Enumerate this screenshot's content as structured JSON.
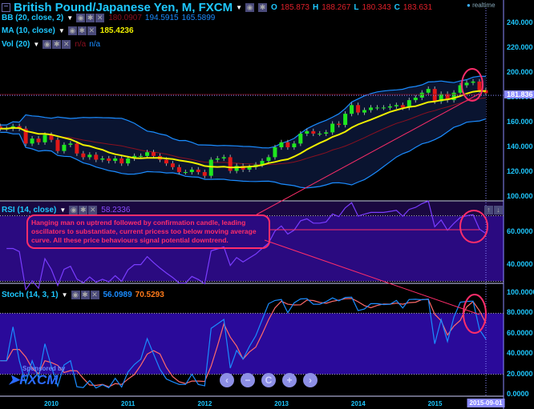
{
  "header": {
    "title": "British Pound/Japanese Yen, M, FXCM",
    "o_label": "O",
    "o": "185.873",
    "h_label": "H",
    "h": "188.267",
    "l_label": "L",
    "l": "180.343",
    "c_label": "C",
    "c": "183.631",
    "realtime": "realtime"
  },
  "indicators": {
    "bb": {
      "label": "BB (20, close, 2)",
      "mid": "180.0907",
      "upper": "194.5915",
      "lower": "165.5899"
    },
    "ma": {
      "label": "MA (10, close)",
      "value": "185.4236"
    },
    "vol": {
      "label": "Vol (20)",
      "v1": "n/a",
      "v2": "n/a"
    },
    "rsi": {
      "label": "RSI (14, close)",
      "value": "58.2336"
    },
    "stoch": {
      "label": "Stoch (14, 3, 1)",
      "k": "56.0989",
      "d": "70.5293"
    }
  },
  "annotation": "Hanging man on uptrend followed by confirmation candle, leading oscillators to substantiate, current pricess too below moving average curve. All these price behaviours signal potential downtrend.",
  "sponsor": {
    "text": "Sponsored by",
    "brand": "FXCM"
  },
  "zoom_controls": [
    "‹",
    "−",
    "C",
    "+",
    "›"
  ],
  "colors": {
    "up": "#1ee81e",
    "down": "#e01818",
    "ma": "#f0f000",
    "bb_band": "#1a8cff",
    "bb_mid": "#8a1020",
    "rsi": "#7a3cff",
    "stoch_k": "#1a8cff",
    "stoch_d": "#ff6a6a",
    "panel_fill": "#2a0a9a",
    "annotation": "#ff2d6a"
  },
  "chart_data": [
    {
      "type": "candlestick",
      "title": "British Pound/Japanese Yen, M, FXCM",
      "start_month": "2009-05",
      "current_price": "181.836",
      "closes": [
        155,
        155,
        157,
        155,
        143,
        147,
        144,
        150,
        146,
        137,
        142,
        143,
        135,
        132,
        134,
        130,
        131,
        129,
        131,
        127,
        131,
        133,
        133,
        136,
        133,
        130,
        127,
        124,
        120,
        120,
        122,
        120,
        117,
        130,
        131,
        132,
        121,
        125,
        122,
        124,
        126,
        129,
        132,
        140,
        144,
        140,
        143,
        151,
        153,
        151,
        151,
        152,
        159,
        158,
        167,
        174,
        168,
        170,
        172,
        172,
        172,
        173,
        174,
        172,
        178,
        180,
        184,
        187,
        177,
        183,
        178,
        184,
        190,
        192,
        193,
        186,
        183.631
      ],
      "y_ticks": [
        "240.000",
        "220.000",
        "200.000",
        "180.000",
        "160.000",
        "140.000",
        "120.000",
        "100.000"
      ],
      "ylim": [
        100,
        240
      ]
    },
    {
      "type": "line",
      "title": "RSI (14, close)",
      "y_ticks": [
        "60.0000",
        "40.0000"
      ],
      "levels": [
        70,
        30
      ]
    },
    {
      "type": "line",
      "title": "Stoch (14, 3, 1)",
      "y_ticks": [
        "100.0000",
        "80.0000",
        "60.0000",
        "40.0000",
        "20.0000",
        "0.0000"
      ],
      "levels": [
        80,
        20
      ]
    }
  ],
  "x_axis": {
    "ticks": [
      "2010",
      "2011",
      "2012",
      "2013",
      "2014",
      "2015"
    ],
    "cursor_date": "2015-09-01"
  }
}
